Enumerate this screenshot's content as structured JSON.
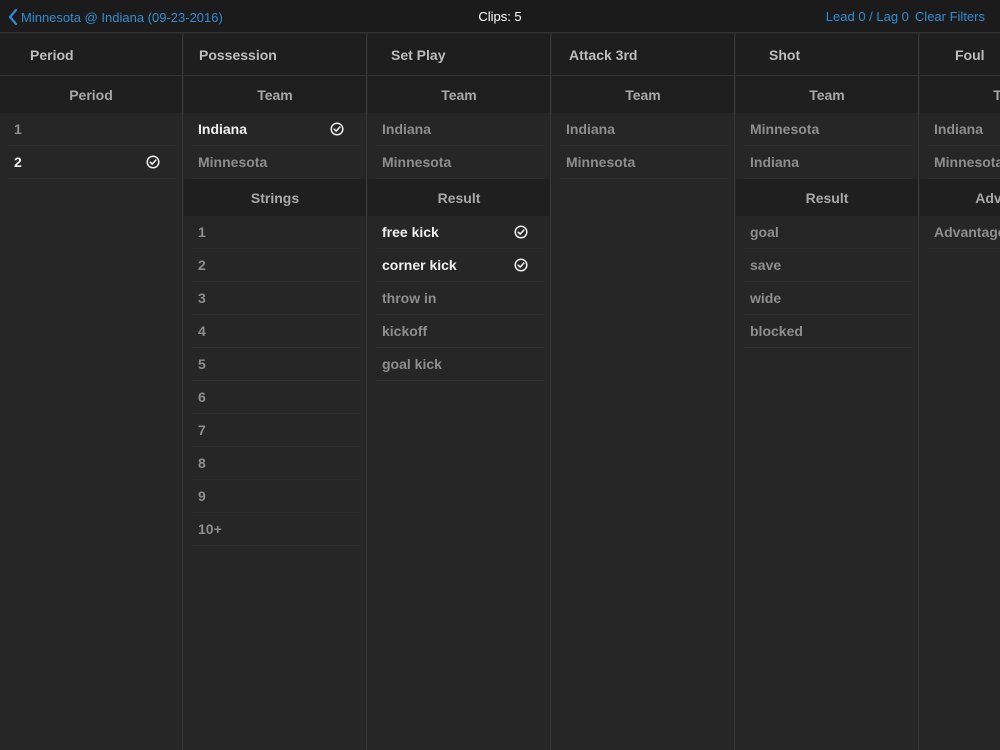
{
  "topbar": {
    "back_label": "Minnesota @ Indiana (09-23-2016)",
    "clips_label": "Clips: 5",
    "lead_lag_label": "Lead 0 / Lag 0",
    "clear_label": "Clear Filters"
  },
  "colors": {
    "accent": "#2b8fd6",
    "background": "#252525",
    "header": "#1e1e1e",
    "selected_text": "#f2f2f2",
    "unselected_text": "#8e8e8e"
  },
  "columns": [
    {
      "title": "Period",
      "sections": [
        {
          "title": "Period",
          "items": [
            {
              "label": "1",
              "selected": false
            },
            {
              "label": "2",
              "selected": true
            }
          ]
        }
      ]
    },
    {
      "title": "Possession",
      "sections": [
        {
          "title": "Team",
          "items": [
            {
              "label": "Indiana",
              "selected": true
            },
            {
              "label": "Minnesota",
              "selected": false
            }
          ]
        },
        {
          "title": "Strings",
          "items": [
            {
              "label": "1",
              "selected": false
            },
            {
              "label": "2",
              "selected": false
            },
            {
              "label": "3",
              "selected": false
            },
            {
              "label": "4",
              "selected": false
            },
            {
              "label": "5",
              "selected": false
            },
            {
              "label": "6",
              "selected": false
            },
            {
              "label": "7",
              "selected": false
            },
            {
              "label": "8",
              "selected": false
            },
            {
              "label": "9",
              "selected": false
            },
            {
              "label": "10+",
              "selected": false
            }
          ]
        }
      ]
    },
    {
      "title": "Set Play",
      "sections": [
        {
          "title": "Team",
          "items": [
            {
              "label": "Indiana",
              "selected": false
            },
            {
              "label": "Minnesota",
              "selected": false
            }
          ]
        },
        {
          "title": "Result",
          "items": [
            {
              "label": "free kick",
              "selected": true
            },
            {
              "label": "corner kick",
              "selected": true
            },
            {
              "label": "throw in",
              "selected": false
            },
            {
              "label": "kickoff",
              "selected": false
            },
            {
              "label": "goal kick",
              "selected": false
            }
          ]
        }
      ]
    },
    {
      "title": "Attack 3rd",
      "sections": [
        {
          "title": "Team",
          "items": [
            {
              "label": "Indiana",
              "selected": false
            },
            {
              "label": "Minnesota",
              "selected": false
            }
          ]
        }
      ]
    },
    {
      "title": "Shot",
      "sections": [
        {
          "title": "Team",
          "items": [
            {
              "label": "Minnesota",
              "selected": false
            },
            {
              "label": "Indiana",
              "selected": false
            }
          ]
        },
        {
          "title": "Result",
          "items": [
            {
              "label": "goal",
              "selected": false
            },
            {
              "label": "save",
              "selected": false
            },
            {
              "label": "wide",
              "selected": false
            },
            {
              "label": "blocked",
              "selected": false
            }
          ]
        }
      ]
    },
    {
      "title": "Foul",
      "sections": [
        {
          "title": "Team",
          "items": [
            {
              "label": "Indiana",
              "selected": false
            },
            {
              "label": "Minnesota",
              "selected": false
            }
          ]
        },
        {
          "title": "Advantage",
          "items": [
            {
              "label": "Advantage",
              "selected": false
            }
          ]
        }
      ]
    }
  ]
}
